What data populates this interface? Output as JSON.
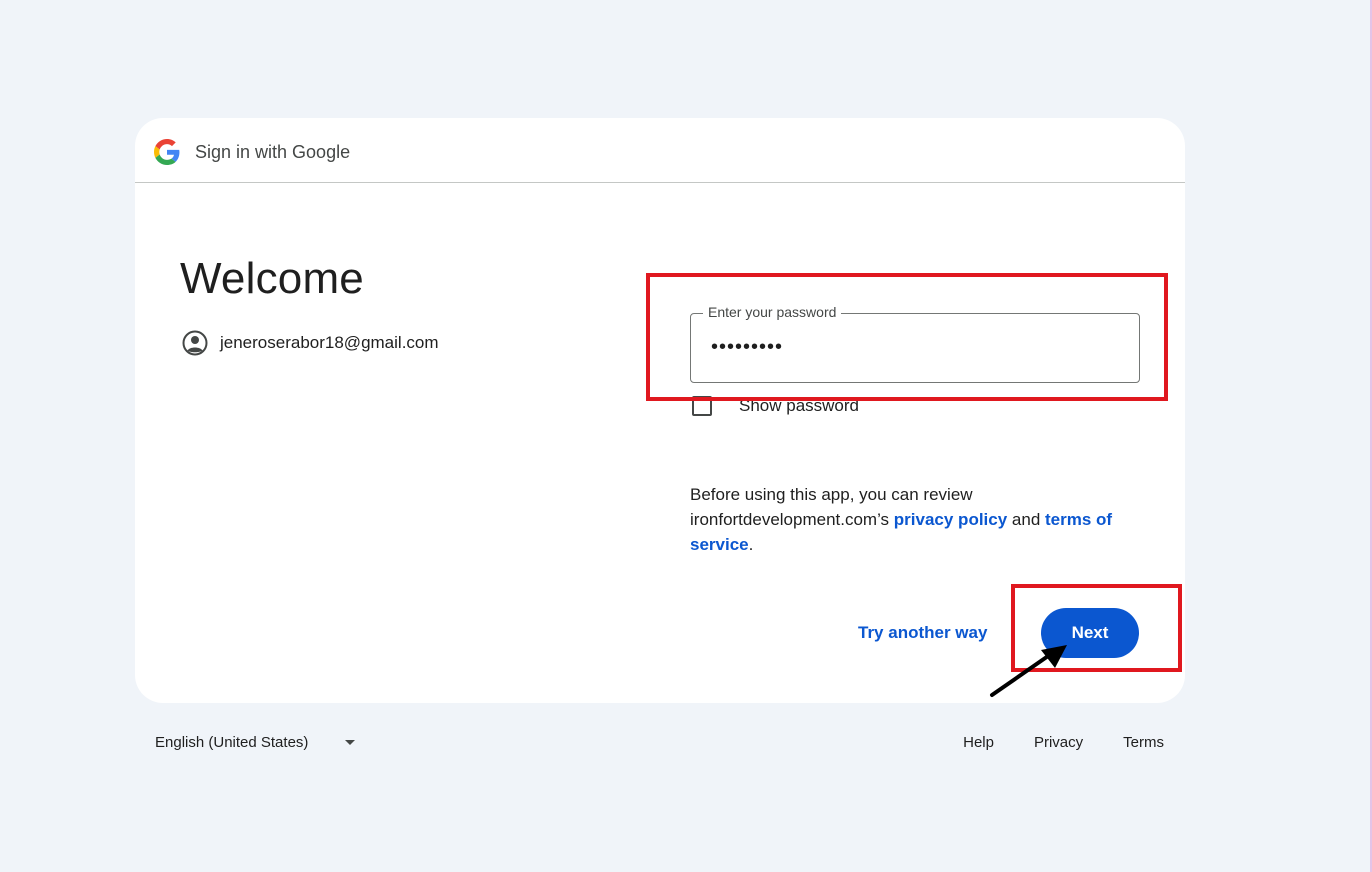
{
  "header": {
    "title": "Sign in with Google",
    "logo_icon": "google-g-icon"
  },
  "main": {
    "heading": "Welcome",
    "account_email": "jeneroserabor18@gmail.com",
    "account_icon": "account-circle-icon"
  },
  "password": {
    "label": "Enter your password",
    "masked_value": "•••••••••",
    "show_password_label": "Show password",
    "show_password_checked": false
  },
  "consent": {
    "text_1": "Before using this app, you can review ironfortdevelopment.com’s ",
    "privacy_link": "privacy policy",
    "text_2": " and ",
    "terms_link": "terms of service",
    "text_3": "."
  },
  "actions": {
    "try_another_way": "Try another way",
    "next": "Next"
  },
  "footer": {
    "language": "English (United States)",
    "help": "Help",
    "privacy": "Privacy",
    "terms": "Terms"
  },
  "colors": {
    "background": "#f0f4f9",
    "primary": "#0b57d0",
    "annotation_red": "#e0181f"
  }
}
